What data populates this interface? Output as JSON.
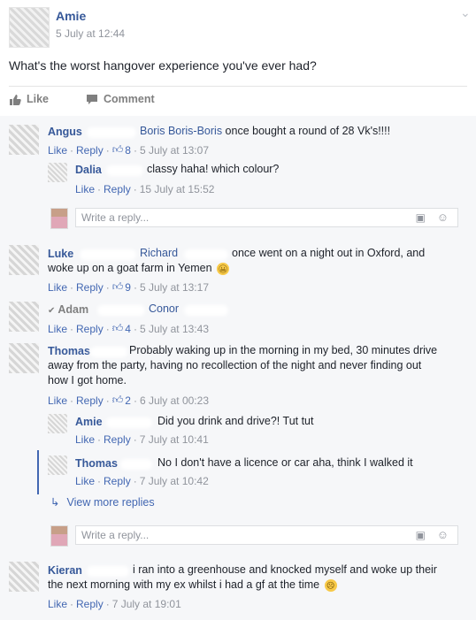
{
  "post": {
    "author": "Amie",
    "timestamp": "5 July at 12:44",
    "text": "What's the worst hangover experience you've ever had?",
    "like_label": "Like",
    "comment_label": "Comment"
  },
  "comments": [
    {
      "name": "Angus",
      "tag": "Boris Boris-Boris",
      "text": " once bought a round of 28 Vk's!!!!",
      "like": "Like",
      "reply": "Reply",
      "likes": "8",
      "time": "5 July at 13:07"
    },
    {
      "name": "Dalia",
      "text": "classy haha! which colour?",
      "like": "Like",
      "reply": "Reply",
      "time": "15 July at 15:52"
    },
    {
      "name": "Luke",
      "tag": "Richard",
      "text": "once went on a night out in Oxford, and",
      "text2": "woke up on a goat farm in Yemen",
      "like": "Like",
      "reply": "Reply",
      "likes": "9",
      "time": "5 July at 13:17"
    },
    {
      "name": "Adam",
      "tag": "Conor",
      "like": "Like",
      "reply": "Reply",
      "likes": "4",
      "time": "5 July at 13:43"
    },
    {
      "name": "Thomas",
      "text": "Probably waking up in the morning in my bed, 30 minutes drive",
      "text2": "away from the party, having no recollection of the night and never finding out",
      "text3": "how I got home.",
      "like": "Like",
      "reply": "Reply",
      "likes": "2",
      "time": "6 July at 00:23"
    },
    {
      "name": "Amie",
      "text": "Did you drink and drive?! Tut tut",
      "like": "Like",
      "reply": "Reply",
      "time": "7 July at 10:41"
    },
    {
      "name": "Thomas",
      "text": "No I don't have a licence or car aha, think I walked it",
      "like": "Like",
      "reply": "Reply",
      "time": "7 July at 10:42"
    },
    {
      "name": "Kieran",
      "text": "i ran into a greenhouse and knocked myself and woke up their",
      "text2": "the next morning with my ex whilst i had a gf at the time",
      "like": "Like",
      "reply": "Reply",
      "time": "7 July at 19:01"
    }
  ],
  "reply_placeholder": "Write a reply...",
  "view_more": "View more replies",
  "separator": "·",
  "icons": {
    "like": "thumbs-up-icon",
    "comment": "speech-bubble-icon",
    "camera": "camera-icon",
    "emoji": "smiley-icon",
    "chevron": "chevron-down-icon",
    "reply_arrow": "reply-arrow-icon"
  },
  "colors": {
    "link": "#365899",
    "action_link": "#4267b2",
    "meta_gray": "#90949c",
    "comments_bg": "#f6f7f9"
  }
}
